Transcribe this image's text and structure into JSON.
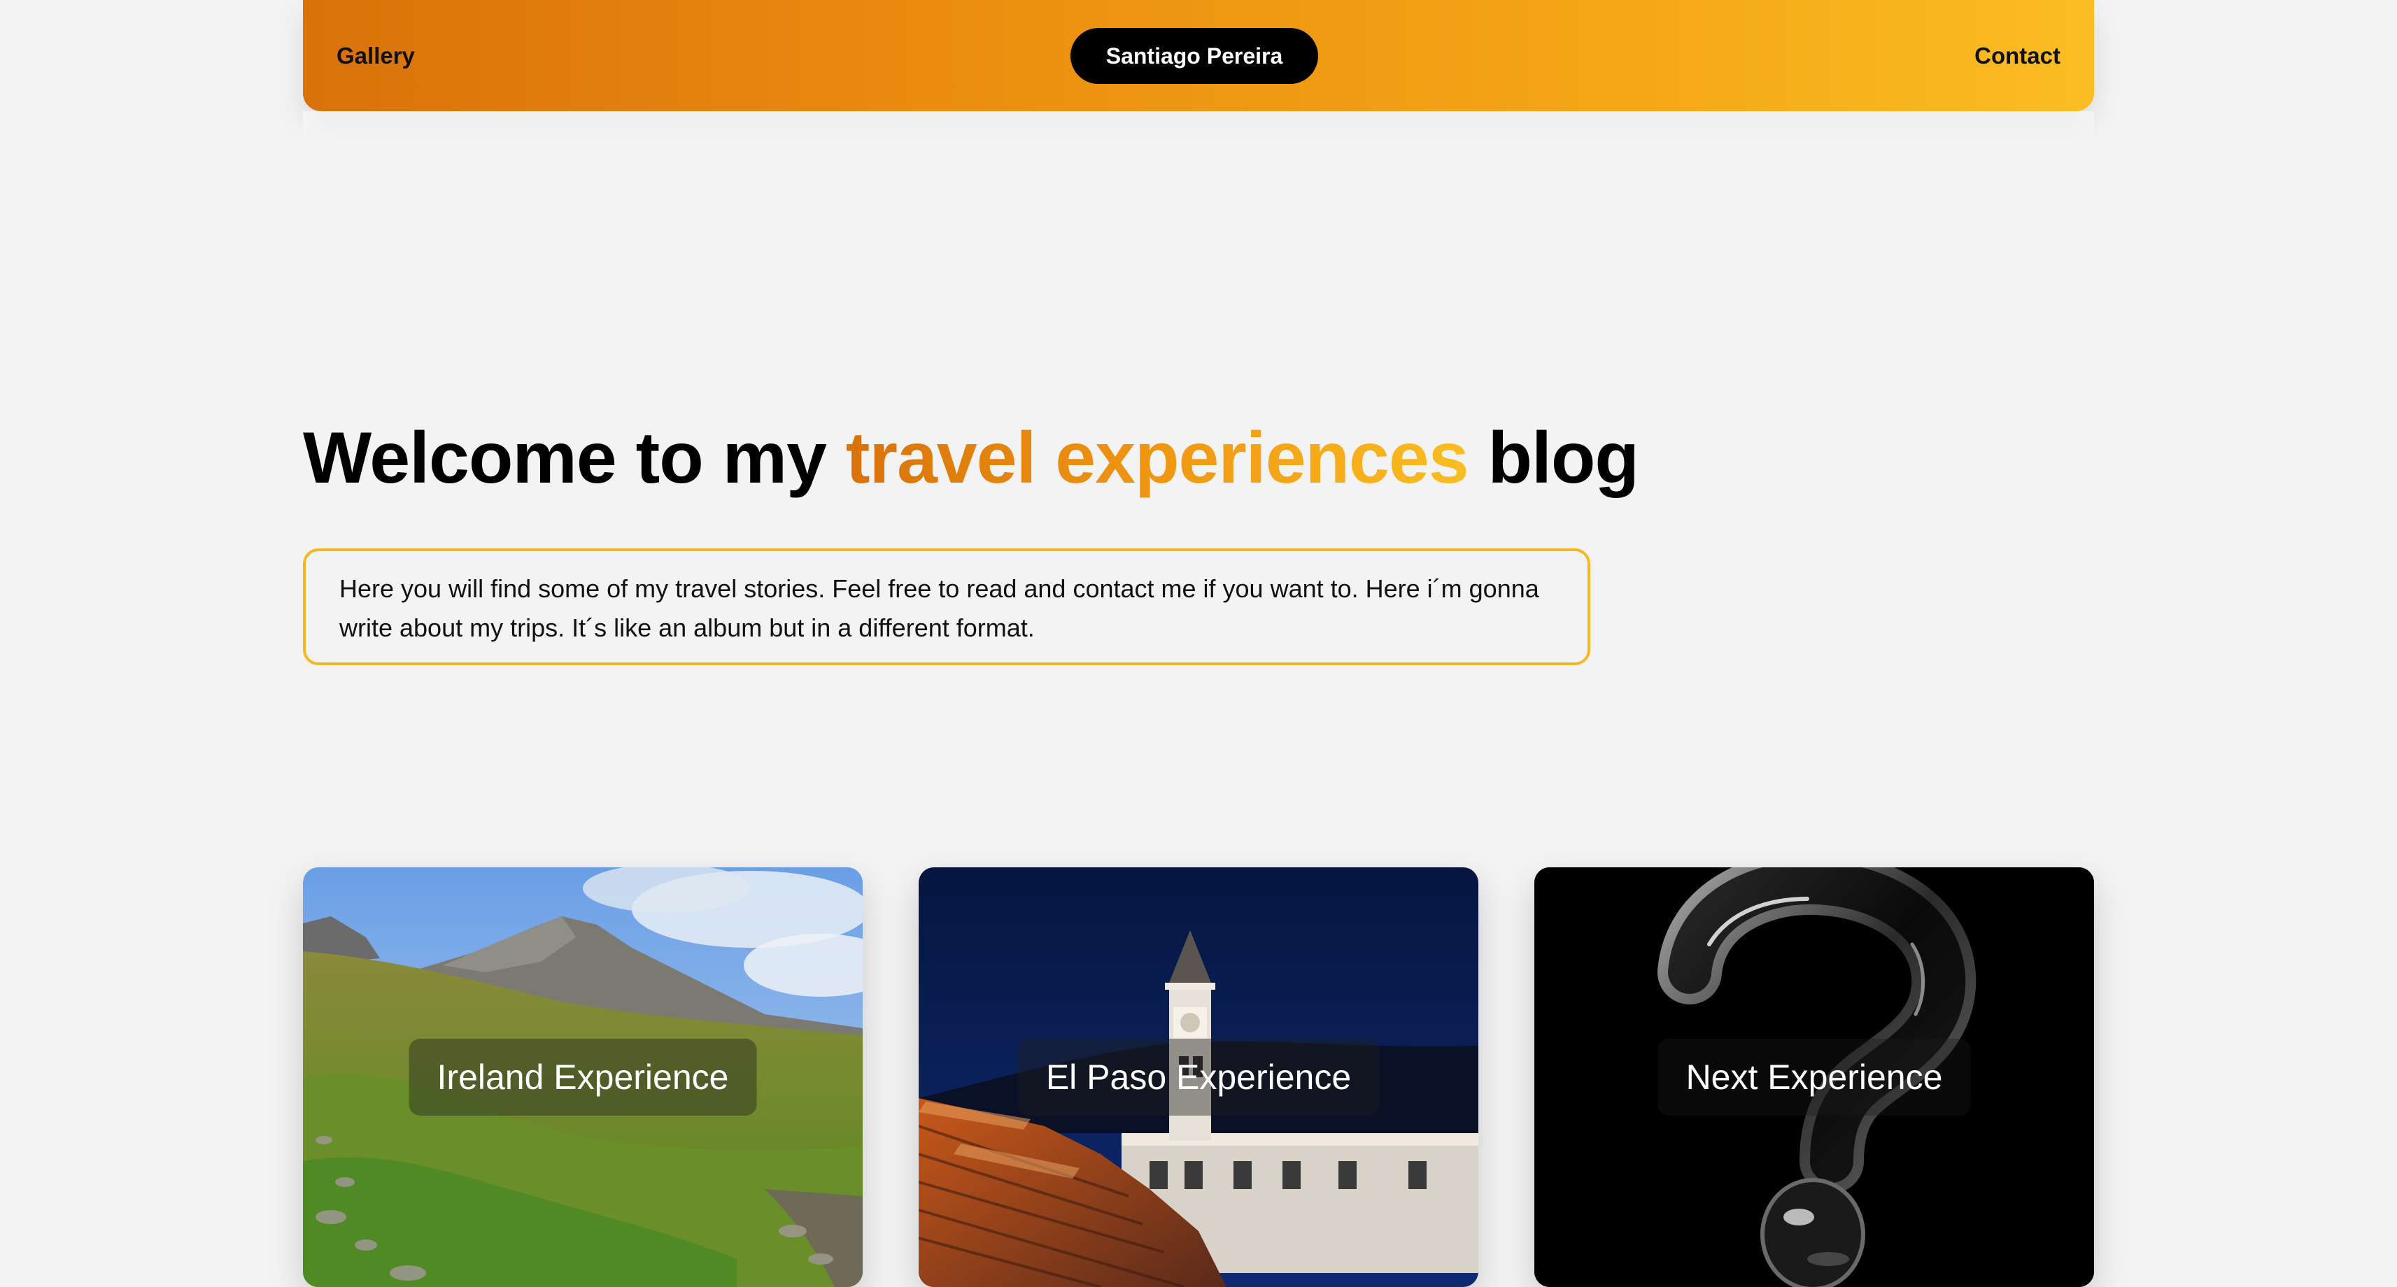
{
  "header": {
    "gallery_label": "Gallery",
    "brand_name": "Santiago Pereira",
    "contact_label": "Contact"
  },
  "hero": {
    "title_prefix": "Welcome to my ",
    "title_accent": "travel experiences",
    "title_suffix": " blog",
    "intro_text": "Here you will find some of my travel stories. Feel free to read and contact me if you want to. Here i´m gonna write about my trips. It´s like an album but in a different format."
  },
  "cards": [
    {
      "title": "Ireland Experience",
      "image": "mountain-landscape"
    },
    {
      "title": "El Paso Experience",
      "image": "church-tower-at-night"
    },
    {
      "title": "Next Experience",
      "image": "question-mark"
    }
  ],
  "colors": {
    "accent_start": "#d8720a",
    "accent_end": "#fbbd22",
    "page_background": "#f3f3f3",
    "intro_border": "#f6b820"
  }
}
